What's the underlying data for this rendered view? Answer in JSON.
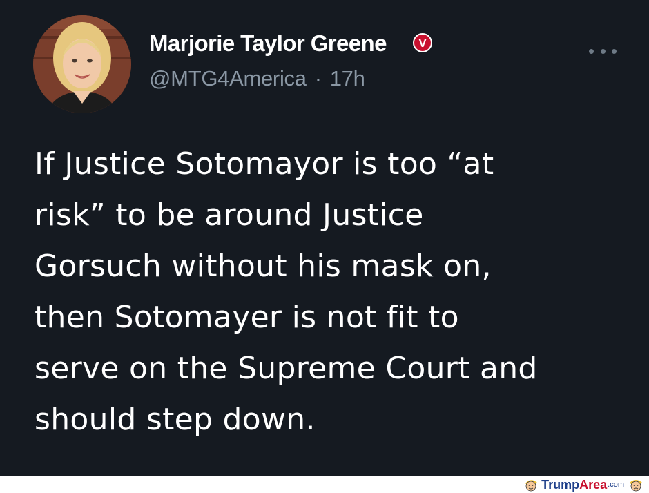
{
  "tweet": {
    "display_name": "Marjorie Taylor Greene",
    "verified_badge": "V",
    "handle": "@MTG4America",
    "separator": "·",
    "time": "17h",
    "more_icon": "more-horizontal-icon",
    "text_lines": [
      "If Justice Sotomayor is too “at",
      "risk” to be around Justice",
      "Gorsuch without his mask on,",
      "then Sotomayer is not fit to",
      "serve on the Supreme Court and",
      "should step down."
    ]
  },
  "watermark": {
    "brand_part1": "Trump",
    "brand_part2": "Area",
    "suffix": ".com"
  },
  "colors": {
    "background": "#151a21",
    "text": "#ffffff",
    "secondary_text": "#8b98a5",
    "badge": "#c8102e",
    "watermark_blue": "#1e3f8a",
    "watermark_red": "#c8102e"
  }
}
